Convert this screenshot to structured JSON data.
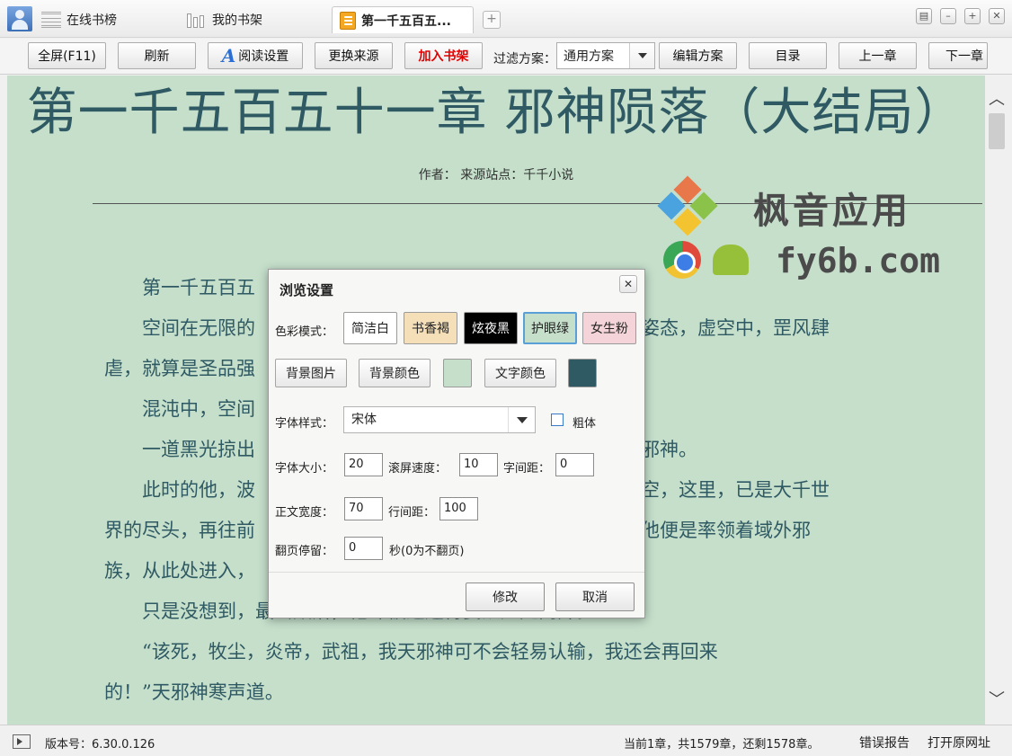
{
  "tabs": [
    {
      "label": "在线书榜"
    },
    {
      "label": "我的书架"
    },
    {
      "label": "第一千五百五..."
    }
  ],
  "window_buttons": [
    "▤",
    "–",
    "+",
    "✕"
  ],
  "toolbar": {
    "fullscreen": "全屏(F11)",
    "refresh": "刷新",
    "reading_settings": "阅读设置",
    "change_source": "更换来源",
    "add_to_shelf": "加入书架",
    "filter_label": "过滤方案：",
    "filter_value": "通用方案",
    "edit_scheme": "编辑方案",
    "toc": "目录",
    "prev_chapter": "上一章",
    "next_chapter": "下一章"
  },
  "reader": {
    "title": "第一千五百五十一章  邪神陨落（大结局）",
    "meta": "作者：  来源站点：千千小说",
    "paragraphs": [
      "第一千五百五",
      "空间在无限的",
      "姿态，虚空中，罡风肆",
      "虐，就算是圣品强",
      "混沌中，空间",
      "一道黑光掠出",
      "邪神。",
      "此时的他，波",
      "空，这里，已是大千世",
      "界的尽头，再往前",
      "他便是率领着域外邪",
      "族，从此处进入，",
      "只是没想到，最终败落，他却被逼迫得要从此处离开。",
      "“该死，牧尘，炎帝，武祖，我天邪神可不会轻易认输，我还会再回来",
      "的！”天邪神寒声道。"
    ],
    "bg_color": "#c5dfcb",
    "text_color": "#2f5963"
  },
  "watermark": {
    "brand": "枫音应用",
    "url": "fy6b.com"
  },
  "status": {
    "version": "版本号：6.30.0.126",
    "chapter_info": "当前1章，共1579章，还剩1578章。",
    "error_report": "错误报告",
    "open_url": "打开原网址"
  },
  "dialog": {
    "title": "浏览设置",
    "close": "✕",
    "color_mode_label": "色彩模式：",
    "modes": [
      {
        "label": "简洁白",
        "bg": "#ffffff",
        "fg": "#222222"
      },
      {
        "label": "书香褐",
        "bg": "#f4dfb8",
        "fg": "#222222"
      },
      {
        "label": "炫夜黑",
        "bg": "#000000",
        "fg": "#ffffff"
      },
      {
        "label": "护眼绿",
        "bg": "#c5dfcb",
        "fg": "#222222"
      },
      {
        "label": "女生粉",
        "bg": "#f4d4d8",
        "fg": "#222222"
      }
    ],
    "bg_image": "背景图片",
    "bg_color_label": "背景颜色",
    "bg_swatch": "#c5dfcb",
    "text_color_label": "文字颜色",
    "text_swatch": "#2f5963",
    "font_style_label": "字体样式：",
    "font_value": "宋体",
    "bold_label": "粗体",
    "font_size_label": "字体大小：",
    "font_size": "20",
    "scroll_speed_label": "滚屏速度：",
    "scroll_speed": "10",
    "letter_spacing_label": "字间距：",
    "letter_spacing": "0",
    "body_width_label": "正文宽度：",
    "body_width": "70",
    "line_spacing_label": "行间距：",
    "line_spacing": "100",
    "page_pause_label": "翻页停留：",
    "page_pause": "0",
    "page_pause_hint": "秒(0为不翻页)",
    "ok": "修改",
    "cancel": "取消"
  }
}
